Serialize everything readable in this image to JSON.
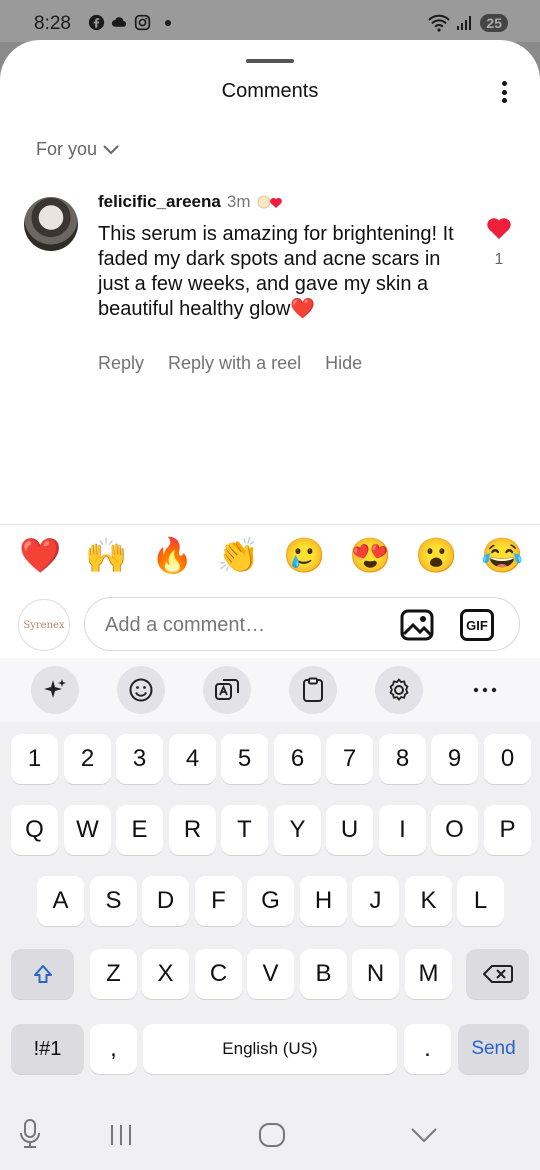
{
  "status": {
    "time": "8:28",
    "battery": "25"
  },
  "sheet": {
    "title": "Comments",
    "filter": "For you"
  },
  "comment": {
    "username": "felicific_areena",
    "time": "3m",
    "text": "This serum is amazing for brightening! It faded my dark spots and acne scars in just a few weeks, and gave my skin a beautiful healthy glow❤️",
    "likes": "1",
    "actions": [
      "Reply",
      "Reply with a reel",
      "Hide"
    ]
  },
  "reactions": [
    "❤️",
    "🙌",
    "🔥",
    "👏",
    "🥲",
    "😍",
    "😮",
    "😂"
  ],
  "input": {
    "brand": "Syrenex",
    "placeholder": "Add a comment…",
    "gif": "GIF"
  },
  "keyboard": {
    "row1": [
      "1",
      "2",
      "3",
      "4",
      "5",
      "6",
      "7",
      "8",
      "9",
      "0"
    ],
    "row2": [
      "Q",
      "W",
      "E",
      "R",
      "T",
      "Y",
      "U",
      "I",
      "O",
      "P"
    ],
    "row3": [
      "A",
      "S",
      "D",
      "F",
      "G",
      "H",
      "J",
      "K",
      "L"
    ],
    "row4": [
      "Z",
      "X",
      "C",
      "V",
      "B",
      "N",
      "M"
    ],
    "symbols": "!#1",
    "comma": ",",
    "space": "English (US)",
    "period": ".",
    "send": "Send"
  }
}
